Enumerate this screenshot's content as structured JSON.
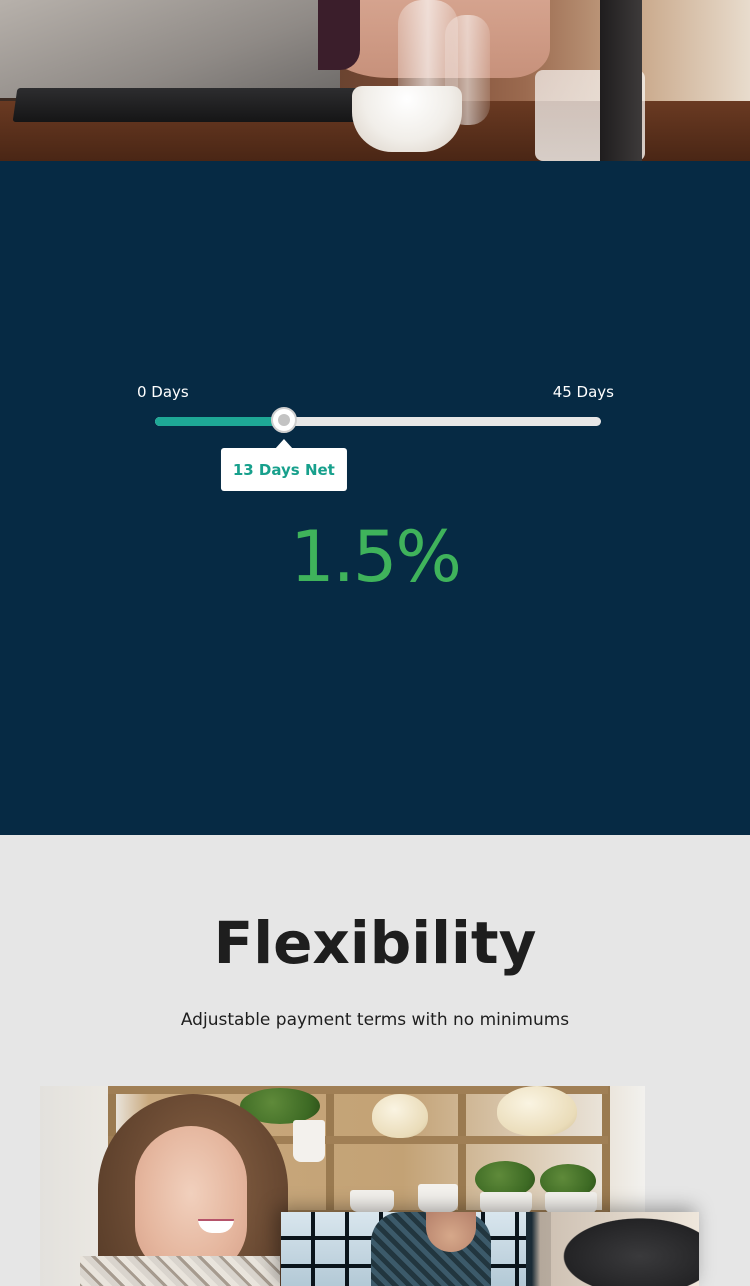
{
  "calculator": {
    "min_label": "0 Days",
    "max_label": "45 Days",
    "slider_min": 0,
    "slider_max": 45,
    "slider_value": 13,
    "tooltip": "13 Days Net",
    "rate": "1.5%",
    "colors": {
      "background": "#062a44",
      "track_fill": "#1ea896",
      "tooltip_text": "#17a08c",
      "rate": "#3fb35b"
    }
  },
  "flexibility": {
    "title": "Flexibility",
    "subtitle": "Adjustable payment terms with no minimums"
  }
}
